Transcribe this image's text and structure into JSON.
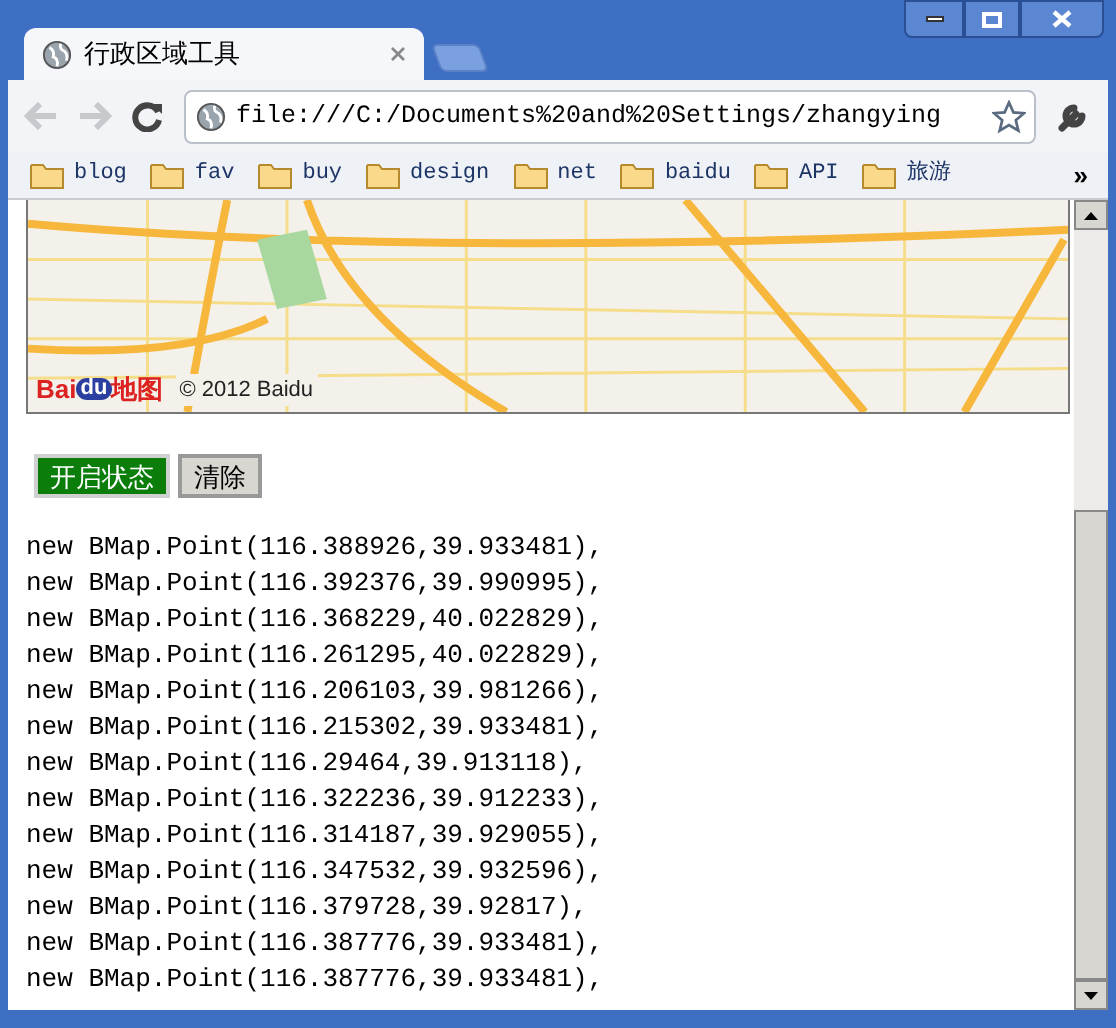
{
  "tab": {
    "title": "行政区域工具",
    "selected": true
  },
  "address_bar": {
    "value": "file:///C:/Documents%20and%20Settings/zhangying"
  },
  "bookmarks": [
    {
      "label": "blog"
    },
    {
      "label": "fav"
    },
    {
      "label": "buy"
    },
    {
      "label": "design"
    },
    {
      "label": "net"
    },
    {
      "label": "baidu"
    },
    {
      "label": "API"
    },
    {
      "label": "旅游"
    }
  ],
  "bookmarks_overflow": "»",
  "map": {
    "logo": {
      "left": "Bai",
      "badge": "du",
      "right": "地图"
    },
    "copyright": "© 2012 Baidu"
  },
  "buttons": [
    {
      "label": "开启状态",
      "active": true
    },
    {
      "label": "清除",
      "active": false
    }
  ],
  "output_lines": [
    "new BMap.Point(116.388926,39.933481),",
    "new BMap.Point(116.392376,39.990995),",
    "new BMap.Point(116.368229,40.022829),",
    "new BMap.Point(116.261295,40.022829),",
    "new BMap.Point(116.206103,39.981266),",
    "new BMap.Point(116.215302,39.933481),",
    "new BMap.Point(116.29464,39.913118),",
    "new BMap.Point(116.322236,39.912233),",
    "new BMap.Point(116.314187,39.929055),",
    "new BMap.Point(116.347532,39.932596),",
    "new BMap.Point(116.379728,39.92817),",
    "new BMap.Point(116.387776,39.933481),",
    "new BMap.Point(116.387776,39.933481),"
  ]
}
